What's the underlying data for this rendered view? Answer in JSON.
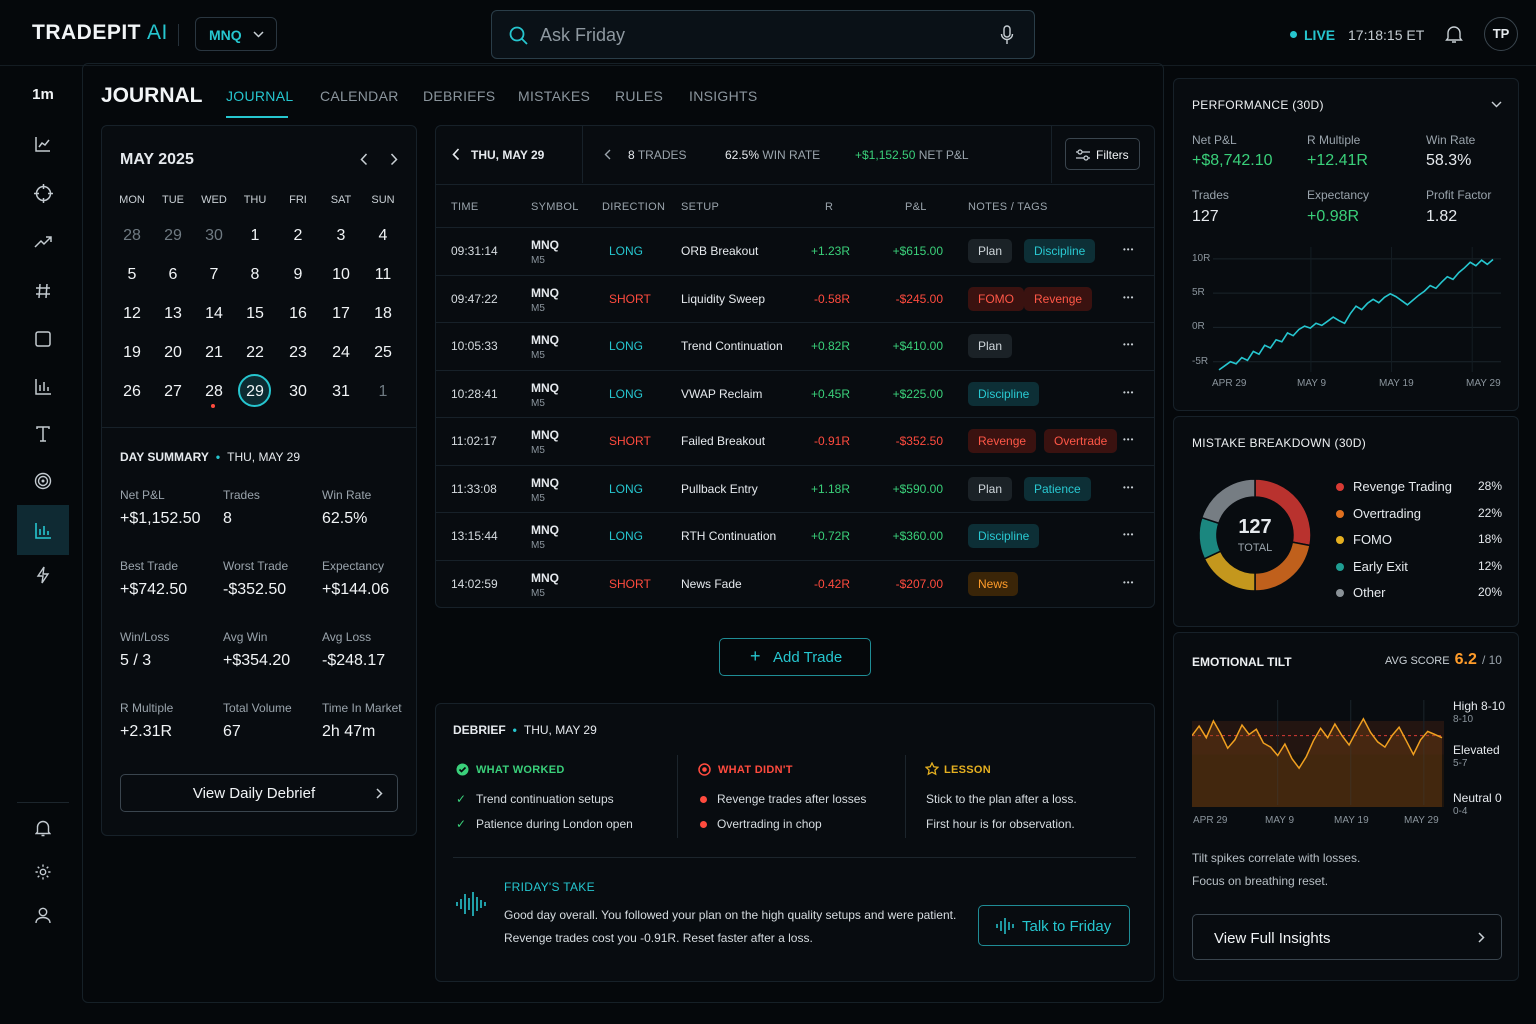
{
  "header": {
    "logo_text": "TRADEPIT",
    "logo_ai": "AI",
    "symbol": "MNQ",
    "search_placeholder": "Ask Friday",
    "live": "LIVE",
    "clock": "17:18:15 ET",
    "avatar": "TP"
  },
  "sidebar": {
    "timeframe": "1m",
    "items": [
      "chart-line-icon",
      "crosshair-icon",
      "trending-up-icon",
      "hash-icon",
      "square-icon",
      "bar-chart-icon",
      "text-icon",
      "target-icon",
      "journal-bars-icon",
      "lightning-icon"
    ],
    "bottom": [
      "bell-icon",
      "gear-icon",
      "user-icon"
    ]
  },
  "journal": {
    "title": "JOURNAL",
    "tabs": [
      "JOURNAL",
      "CALENDAR",
      "DEBRIEFS",
      "MISTAKES",
      "RULES",
      "INSIGHTS"
    ],
    "active_tab": "JOURNAL"
  },
  "calendar": {
    "month": "MAY 2025",
    "dow": [
      "MON",
      "TUE",
      "WED",
      "THU",
      "FRI",
      "SAT",
      "SUN"
    ],
    "weeks": [
      [
        "28",
        "29",
        "30",
        "1",
        "2",
        "3",
        "4"
      ],
      [
        "5",
        "6",
        "7",
        "8",
        "9",
        "10",
        "11"
      ],
      [
        "12",
        "13",
        "14",
        "15",
        "16",
        "17",
        "18"
      ],
      [
        "19",
        "20",
        "21",
        "22",
        "23",
        "24",
        "25"
      ],
      [
        "26",
        "27",
        "28",
        "29",
        "30",
        "31",
        "1"
      ]
    ],
    "selected": "29"
  },
  "day_summary": {
    "title": "DAY SUMMARY",
    "date": "THU, MAY 29",
    "stats": [
      {
        "label": "Net P&L",
        "value": "+$1,152.50",
        "tone": "pos"
      },
      {
        "label": "Trades",
        "value": "8",
        "tone": ""
      },
      {
        "label": "Win Rate",
        "value": "62.5%",
        "tone": ""
      },
      {
        "label": "Best Trade",
        "value": "+$742.50",
        "tone": "pos"
      },
      {
        "label": "Worst Trade",
        "value": "-$352.50",
        "tone": "neg"
      },
      {
        "label": "Expectancy",
        "value": "+$144.06",
        "tone": ""
      },
      {
        "label": "Win/Loss",
        "value": "5 / 3",
        "tone": ""
      },
      {
        "label": "Avg Win",
        "value": "+$354.20",
        "tone": "pos"
      },
      {
        "label": "Avg Loss",
        "value": "-$248.17",
        "tone": "neg"
      },
      {
        "label": "R Multiple",
        "value": "+2.31R",
        "tone": "pos"
      },
      {
        "label": "Total Volume",
        "value": "67",
        "tone": ""
      },
      {
        "label": "Time In Market",
        "value": "2h 47m",
        "tone": ""
      }
    ],
    "button": "View Daily Debrief"
  },
  "trades": {
    "date": "THU, MAY 29",
    "count": "8",
    "count_label": "TRADES",
    "win_rate": "62.5%",
    "win_rate_label": "WIN RATE",
    "net_pnl": "+$1,152.50",
    "net_pnl_label": "NET P&L",
    "filters": "Filters",
    "columns": [
      "TIME",
      "SYMBOL",
      "DIRECTION",
      "SETUP",
      "R",
      "P&L",
      "NOTES / TAGS"
    ],
    "rows": [
      {
        "time": "09:31:14",
        "symbol": "MNQ",
        "tf": "M5",
        "dir": "LONG",
        "setup": "ORB Breakout",
        "r": "+1.23R",
        "pnl": "+$615.00",
        "tags": [
          {
            "t": "Plan",
            "k": "plan"
          },
          {
            "t": "Discipline",
            "k": "disc"
          }
        ]
      },
      {
        "time": "09:47:22",
        "symbol": "MNQ",
        "tf": "M5",
        "dir": "SHORT",
        "setup": "Liquidity Sweep",
        "r": "-0.58R",
        "pnl": "-$245.00",
        "tags": [
          {
            "t": "FOMO",
            "k": "red"
          },
          {
            "t": "Revenge",
            "k": "red"
          }
        ]
      },
      {
        "time": "10:05:33",
        "symbol": "MNQ",
        "tf": "M5",
        "dir": "LONG",
        "setup": "Trend Continuation",
        "r": "+0.82R",
        "pnl": "+$410.00",
        "tags": [
          {
            "t": "Plan",
            "k": "plan"
          }
        ]
      },
      {
        "time": "10:28:41",
        "symbol": "MNQ",
        "tf": "M5",
        "dir": "LONG",
        "setup": "VWAP Reclaim",
        "r": "+0.45R",
        "pnl": "+$225.00",
        "tags": [
          {
            "t": "Discipline",
            "k": "disc"
          }
        ]
      },
      {
        "time": "11:02:17",
        "symbol": "MNQ",
        "tf": "M5",
        "dir": "SHORT",
        "setup": "Failed Breakout",
        "r": "-0.91R",
        "pnl": "-$352.50",
        "tags": [
          {
            "t": "Revenge",
            "k": "red"
          },
          {
            "t": "Overtrade",
            "k": "red"
          }
        ]
      },
      {
        "time": "11:33:08",
        "symbol": "MNQ",
        "tf": "M5",
        "dir": "LONG",
        "setup": "Pullback Entry",
        "r": "+1.18R",
        "pnl": "+$590.00",
        "tags": [
          {
            "t": "Plan",
            "k": "plan"
          },
          {
            "t": "Patience",
            "k": "disc"
          }
        ]
      },
      {
        "time": "13:15:44",
        "symbol": "MNQ",
        "tf": "M5",
        "dir": "LONG",
        "setup": "RTH Continuation",
        "r": "+0.72R",
        "pnl": "+$360.00",
        "tags": [
          {
            "t": "Discipline",
            "k": "disc"
          }
        ]
      },
      {
        "time": "14:02:59",
        "symbol": "MNQ",
        "tf": "M5",
        "dir": "SHORT",
        "setup": "News Fade",
        "r": "-0.42R",
        "pnl": "-$207.00",
        "tags": [
          {
            "t": "News",
            "k": "news"
          }
        ]
      }
    ],
    "add_button": "Add Trade"
  },
  "debrief": {
    "title": "DEBRIEF",
    "date": "THU, MAY 29",
    "worked_title": "WHAT WORKED",
    "worked": [
      "Trend continuation setups",
      "Patience during London open"
    ],
    "didnt_title": "WHAT DIDN'T",
    "didnt": [
      "Revenge trades after losses",
      "Overtrading in chop"
    ],
    "lesson_title": "LESSON",
    "lesson": [
      "Stick to the plan after a loss.",
      "First hour is for observation."
    ],
    "friday_title": "FRIDAY'S TAKE",
    "friday_text": [
      "Good day overall. You followed your plan on the high quality setups and were patient.",
      "Revenge trades cost you -0.91R. Reset faster after a loss."
    ],
    "talk_button": "Talk to Friday"
  },
  "performance": {
    "title": "PERFORMANCE (30D)",
    "stats": [
      {
        "label": "Net P&L",
        "value": "+$8,742.10",
        "tone": "pos"
      },
      {
        "label": "R Multiple",
        "value": "+12.41R",
        "tone": "pos"
      },
      {
        "label": "Win Rate",
        "value": "58.3%",
        "tone": ""
      },
      {
        "label": "Trades",
        "value": "127",
        "tone": ""
      },
      {
        "label": "Expectancy",
        "value": "+0.98R",
        "tone": "pos"
      },
      {
        "label": "Profit Factor",
        "value": "1.82",
        "tone": ""
      }
    ],
    "chart_data": {
      "type": "line",
      "y_ticks": [
        "10R",
        "5R",
        "0R",
        "-5R"
      ],
      "x_ticks": [
        "APR 29",
        "MAY 9",
        "MAY 19",
        "MAY 29"
      ],
      "ylim": [
        -5,
        10
      ],
      "values": [
        -6.2,
        -5.6,
        -5.0,
        -5.3,
        -4.4,
        -4.8,
        -3.5,
        -3.9,
        -2.6,
        -3.0,
        -1.8,
        -2.1,
        -0.8,
        -1.2,
        -0.3,
        0.2,
        -0.1,
        0.6,
        0.3,
        0.9,
        1.5,
        1.0,
        0.6,
        2.0,
        3.1,
        2.6,
        3.5,
        4.1,
        3.6,
        4.4,
        4.9,
        4.5,
        3.9,
        3.3,
        4.0,
        4.7,
        5.3,
        6.1,
        5.7,
        6.6,
        7.4,
        7.0,
        8.0,
        8.7,
        9.5,
        9.0,
        9.8,
        9.2,
        9.9
      ]
    }
  },
  "mistakes": {
    "title": "MISTAKE BREAKDOWN (30D)",
    "total": "127",
    "total_label": "TOTAL",
    "chart_data": {
      "type": "pie",
      "labels": [
        "Revenge Trading",
        "Overtrading",
        "FOMO",
        "Early Exit",
        "Other"
      ],
      "values": [
        28,
        22,
        18,
        12,
        20
      ],
      "display": [
        "28%",
        "22%",
        "18%",
        "12%",
        "20%"
      ],
      "colors": [
        "#d83a34",
        "#e0701f",
        "#e5b020",
        "#1f9e93",
        "#8a9298"
      ]
    }
  },
  "tilt": {
    "title": "EMOTIONAL TILT",
    "avg_label": "AVG SCORE",
    "avg": "6.2",
    "avg_max": "/ 10",
    "levels": [
      {
        "label": "High 8-10",
        "sub": "8-10"
      },
      {
        "label": "Elevated",
        "sub": "5-7"
      },
      {
        "label": "Neutral 0",
        "sub": "0-4"
      }
    ],
    "x_ticks": [
      "APR 29",
      "MAY 9",
      "MAY 19",
      "MAY 29"
    ],
    "chart_data": {
      "type": "line",
      "ylim": [
        0,
        10
      ],
      "values": [
        6.8,
        7.7,
        6.6,
        8.2,
        7.0,
        5.6,
        6.4,
        7.8,
        6.9,
        7.4,
        6.1,
        5.7,
        4.9,
        6.0,
        4.6,
        3.7,
        4.8,
        6.3,
        7.5,
        6.6,
        7.9,
        6.8,
        5.9,
        7.2,
        8.4,
        7.1,
        6.2,
        5.7,
        6.8,
        7.6,
        6.3,
        5.0,
        6.4,
        7.2,
        6.9,
        6.6
      ]
    },
    "note": [
      "Tilt spikes correlate with losses.",
      "Focus on breathing reset."
    ],
    "button": "View Full Insights"
  }
}
